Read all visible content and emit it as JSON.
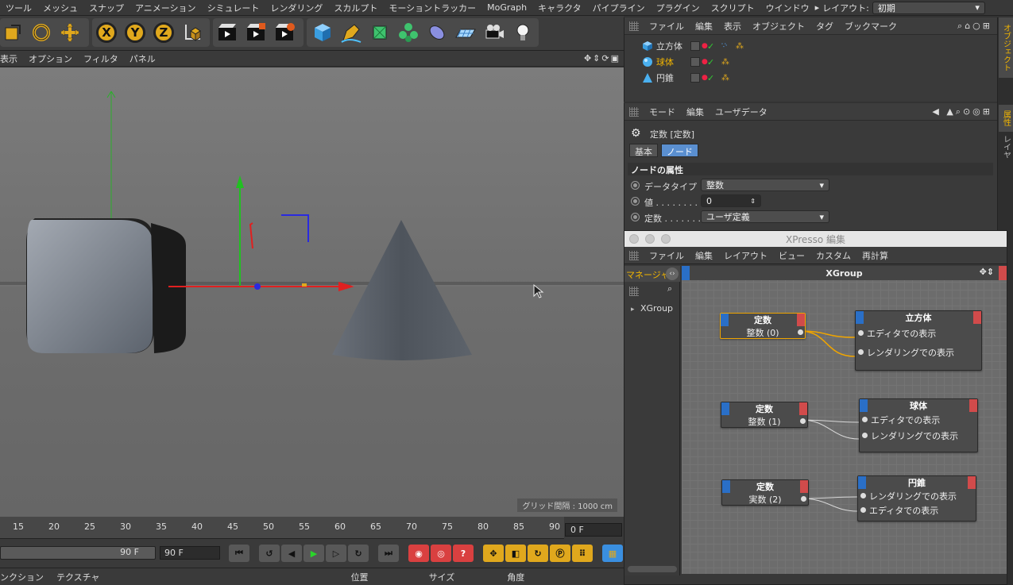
{
  "menubar": {
    "items": [
      "ツール",
      "メッシュ",
      "スナップ",
      "アニメーション",
      "シミュレート",
      "レンダリング",
      "スカルプト",
      "モーショントラッカー",
      "MoGraph",
      "キャラクタ",
      "パイプライン",
      "プラグイン",
      "スクリプト",
      "ウインドウ"
    ],
    "layout_label": "レイアウト:",
    "layout_value": "初期"
  },
  "toolbar": {
    "axis_x": "X",
    "axis_y": "Y",
    "axis_z": "Z"
  },
  "viewport": {
    "menu": [
      "表示",
      "オプション",
      "フィルタ",
      "パネル"
    ],
    "grid_label": "グリッド間隔 : 1000 cm"
  },
  "timeline": {
    "ticks": [
      "15",
      "20",
      "25",
      "30",
      "35",
      "40",
      "45",
      "50",
      "55",
      "60",
      "65",
      "70",
      "75",
      "80",
      "85",
      "90"
    ],
    "current_frame": "0 F",
    "range_end": "90 F",
    "end_frame": "90 F"
  },
  "bottombar": {
    "items": [
      "ンクション",
      "テクスチャ"
    ],
    "coord_headers": [
      "位置",
      "サイズ",
      "角度"
    ]
  },
  "object_manager": {
    "menu": [
      "ファイル",
      "編集",
      "表示",
      "オブジェクト",
      "タグ",
      "ブックマーク"
    ],
    "objects": [
      {
        "name": "立方体",
        "selected": false,
        "icon": "cube-icon"
      },
      {
        "name": "球体",
        "selected": true,
        "icon": "sphere-icon"
      },
      {
        "name": "円錐",
        "selected": false,
        "icon": "cone-icon"
      }
    ]
  },
  "attributes": {
    "menu": [
      "モード",
      "編集",
      "ユーザデータ"
    ],
    "object_title": "定数 [定数]",
    "tabs": [
      "基本",
      "ノード"
    ],
    "active_tab": "ノード",
    "section_title": "ノードの属性",
    "fields": [
      {
        "label": "データタイプ",
        "value": "整数",
        "kind": "select"
      },
      {
        "label": "値 . . . . . . . . . .",
        "value": "0",
        "kind": "number"
      },
      {
        "label": "定数 . . . . . . .",
        "value": "ユーザ定義",
        "kind": "select"
      }
    ]
  },
  "side_tabs": [
    "オブジェクト",
    "属性",
    "レイヤ"
  ],
  "xpresso": {
    "title": "XPresso 編集",
    "menu": [
      "ファイル",
      "編集",
      "レイアウト",
      "ビュー",
      "カスタム",
      "再計算"
    ],
    "manager_title": "マネージャ",
    "tree_item": "XGroup",
    "canvas_title": "XGroup",
    "nodes": [
      {
        "title": "定数",
        "port": "整数 (0)"
      },
      {
        "title": "立方体",
        "ports": [
          "エディタでの表示",
          "レンダリングでの表示"
        ]
      },
      {
        "title": "定数",
        "port": "整数 (1)"
      },
      {
        "title": "球体",
        "ports": [
          "エディタでの表示",
          "レンダリングでの表示"
        ]
      },
      {
        "title": "定数",
        "port": "実数 (2)"
      },
      {
        "title": "円錐",
        "ports": [
          "レンダリングでの表示",
          "エディタでの表示"
        ]
      }
    ]
  },
  "colors": {
    "accent": "#f0b400",
    "node_blue": "#2a6fc7",
    "node_red": "#d14b4b"
  }
}
